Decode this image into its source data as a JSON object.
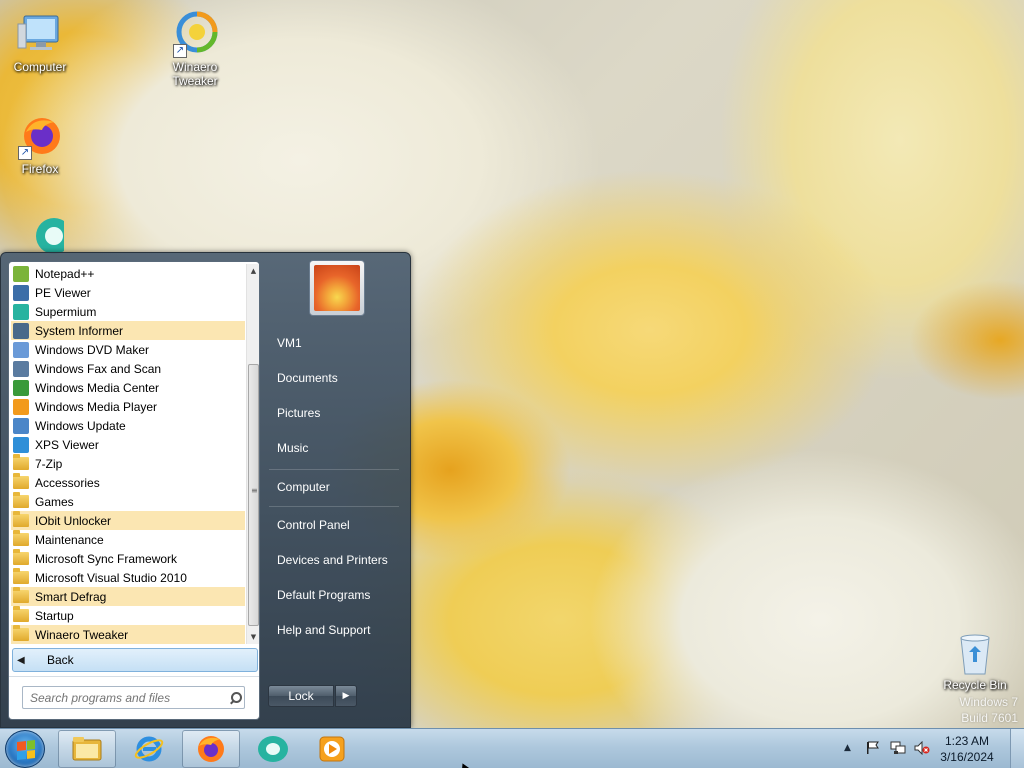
{
  "desktop": {
    "icons": [
      {
        "name": "computer-desktop-icon",
        "label": "Computer"
      },
      {
        "name": "winaero-tweaker-desktop-icon",
        "label": "Winaero Tweaker"
      },
      {
        "name": "firefox-desktop-icon",
        "label": "Firefox"
      },
      {
        "name": "recycle-bin-desktop-icon",
        "label": "Recycle Bin"
      }
    ],
    "watermark": {
      "line1": "Windows 7",
      "line2": "Build 7601"
    }
  },
  "start_menu": {
    "programs": [
      {
        "label": "Notepad++",
        "icon": "notepadpp-icon",
        "type": "app",
        "highlighted": false
      },
      {
        "label": "PE Viewer",
        "icon": "pe-viewer-icon",
        "type": "app",
        "highlighted": false
      },
      {
        "label": "Supermium",
        "icon": "supermium-icon",
        "type": "app",
        "highlighted": false
      },
      {
        "label": "System Informer",
        "icon": "system-informer-icon",
        "type": "app",
        "highlighted": true
      },
      {
        "label": "Windows DVD Maker",
        "icon": "dvd-maker-icon",
        "type": "app",
        "highlighted": false
      },
      {
        "label": "Windows Fax and Scan",
        "icon": "fax-scan-icon",
        "type": "app",
        "highlighted": false
      },
      {
        "label": "Windows Media Center",
        "icon": "media-center-icon",
        "type": "app",
        "highlighted": false
      },
      {
        "label": "Windows Media Player",
        "icon": "media-player-icon",
        "type": "app",
        "highlighted": false
      },
      {
        "label": "Windows Update",
        "icon": "windows-update-icon",
        "type": "app",
        "highlighted": false
      },
      {
        "label": "XPS Viewer",
        "icon": "xps-viewer-icon",
        "type": "app",
        "highlighted": false
      },
      {
        "label": "7-Zip",
        "icon": "folder-icon",
        "type": "folder",
        "highlighted": false
      },
      {
        "label": "Accessories",
        "icon": "folder-icon",
        "type": "folder",
        "highlighted": false
      },
      {
        "label": "Games",
        "icon": "folder-icon",
        "type": "folder",
        "highlighted": false
      },
      {
        "label": "IObit Unlocker",
        "icon": "folder-icon",
        "type": "folder",
        "highlighted": true
      },
      {
        "label": "Maintenance",
        "icon": "folder-icon",
        "type": "folder",
        "highlighted": false
      },
      {
        "label": "Microsoft Sync Framework",
        "icon": "folder-icon",
        "type": "folder",
        "highlighted": false
      },
      {
        "label": "Microsoft Visual Studio 2010",
        "icon": "folder-icon",
        "type": "folder",
        "highlighted": false
      },
      {
        "label": "Smart Defrag",
        "icon": "folder-icon",
        "type": "folder",
        "highlighted": true
      },
      {
        "label": "Startup",
        "icon": "folder-icon",
        "type": "folder",
        "highlighted": false
      },
      {
        "label": "Winaero Tweaker",
        "icon": "folder-icon",
        "type": "folder",
        "highlighted": true
      }
    ],
    "back_label": "Back",
    "search_placeholder": "Search programs and files",
    "right_links": [
      {
        "label": "VM1",
        "name": "right-link-vm1"
      },
      {
        "label": "Documents",
        "name": "right-link-documents"
      },
      {
        "label": "Pictures",
        "name": "right-link-pictures"
      },
      {
        "label": "Music",
        "name": "right-link-music"
      },
      {
        "label": "Computer",
        "name": "right-link-computer"
      },
      {
        "label": "Control Panel",
        "name": "right-link-control-panel"
      },
      {
        "label": "Devices and Printers",
        "name": "right-link-devices-printers"
      },
      {
        "label": "Default Programs",
        "name": "right-link-default-programs"
      },
      {
        "label": "Help and Support",
        "name": "right-link-help-support"
      }
    ],
    "lock_label": "Lock"
  },
  "taskbar": {
    "pinned": [
      {
        "name": "taskbar-explorer-button",
        "icon": "folder-icon"
      },
      {
        "name": "taskbar-ie-button",
        "icon": "internet-explorer-icon"
      },
      {
        "name": "taskbar-firefox-button",
        "icon": "firefox-icon"
      },
      {
        "name": "taskbar-supermium-button",
        "icon": "supermium-icon"
      },
      {
        "name": "taskbar-media-player-button",
        "icon": "media-player-icon"
      }
    ],
    "clock": {
      "time": "1:23 AM",
      "date": "3/16/2024"
    }
  }
}
